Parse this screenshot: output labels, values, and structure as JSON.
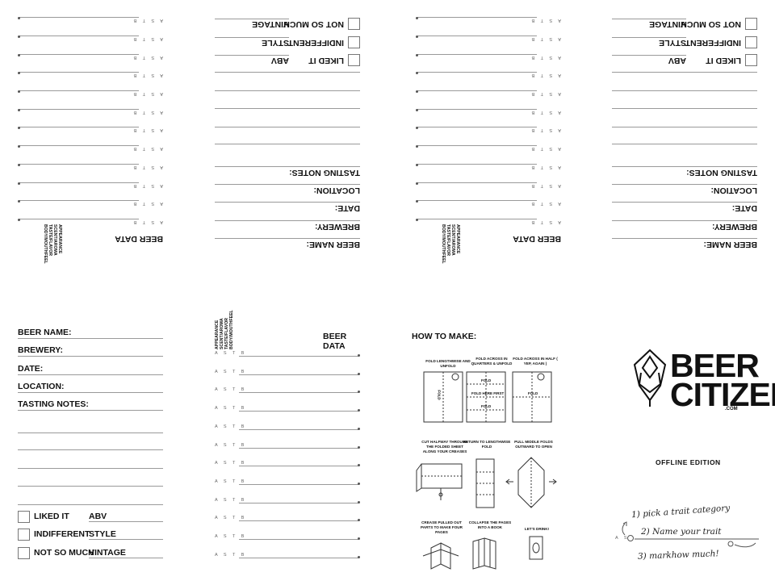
{
  "front": {
    "field_labels": [
      "BEER NAME:",
      "BREWERY:",
      "DATE:",
      "LOCATION:",
      "TASTING NOTES:"
    ],
    "check_options": [
      {
        "check": "LIKED IT",
        "trait": "ABV"
      },
      {
        "check": "INDIFFERENT",
        "trait": "STYLE"
      },
      {
        "check": "NOT SO MUCH",
        "trait": "VINTAGE"
      }
    ]
  },
  "beer_data": {
    "title": "BEER DATA",
    "legend": [
      "APPEARANCE",
      "SCENT/AROMA",
      "TASTE/FLAVOR",
      "BODY/MOUTHFEEL"
    ],
    "row_letters": "A S T B",
    "row_count": 12
  },
  "how_to": {
    "title": "HOW TO MAKE:",
    "steps": [
      "FOLD LENGTHWISE AND UNFOLD",
      "FOLD ACROSS IN QUARTERS & UNFOLD",
      "FOLD ACROSS IN HALF ( YEP, AGAIN )",
      "CUT HALFWAY THROUGH THE FOLDED SHEET ALONG YOUR CREASES",
      "RETURN TO LENGTHWISE FOLD",
      "PULL MIDDLE FOLDS OUTWARD TO OPEN",
      "CREASE PULLED OUT PARTS TO MAKE FOUR PAGES",
      "COLLAPSE THE PAGES INTO A BOOK",
      "LET'S DRINK!"
    ],
    "diagram_labels": {
      "fold": "FOLD",
      "fold_here_first": "FOLD HERE FIRST"
    }
  },
  "logo": {
    "line1": "BEER",
    "line2": "CITIZEN",
    "tld": ".COM",
    "edition": "OFFLINE EDITION"
  },
  "legend_hand": {
    "step1": "1) pick a trait category",
    "step2": "2) Name your trait",
    "step3": "3) markhow much!",
    "row_letters": "A S"
  }
}
